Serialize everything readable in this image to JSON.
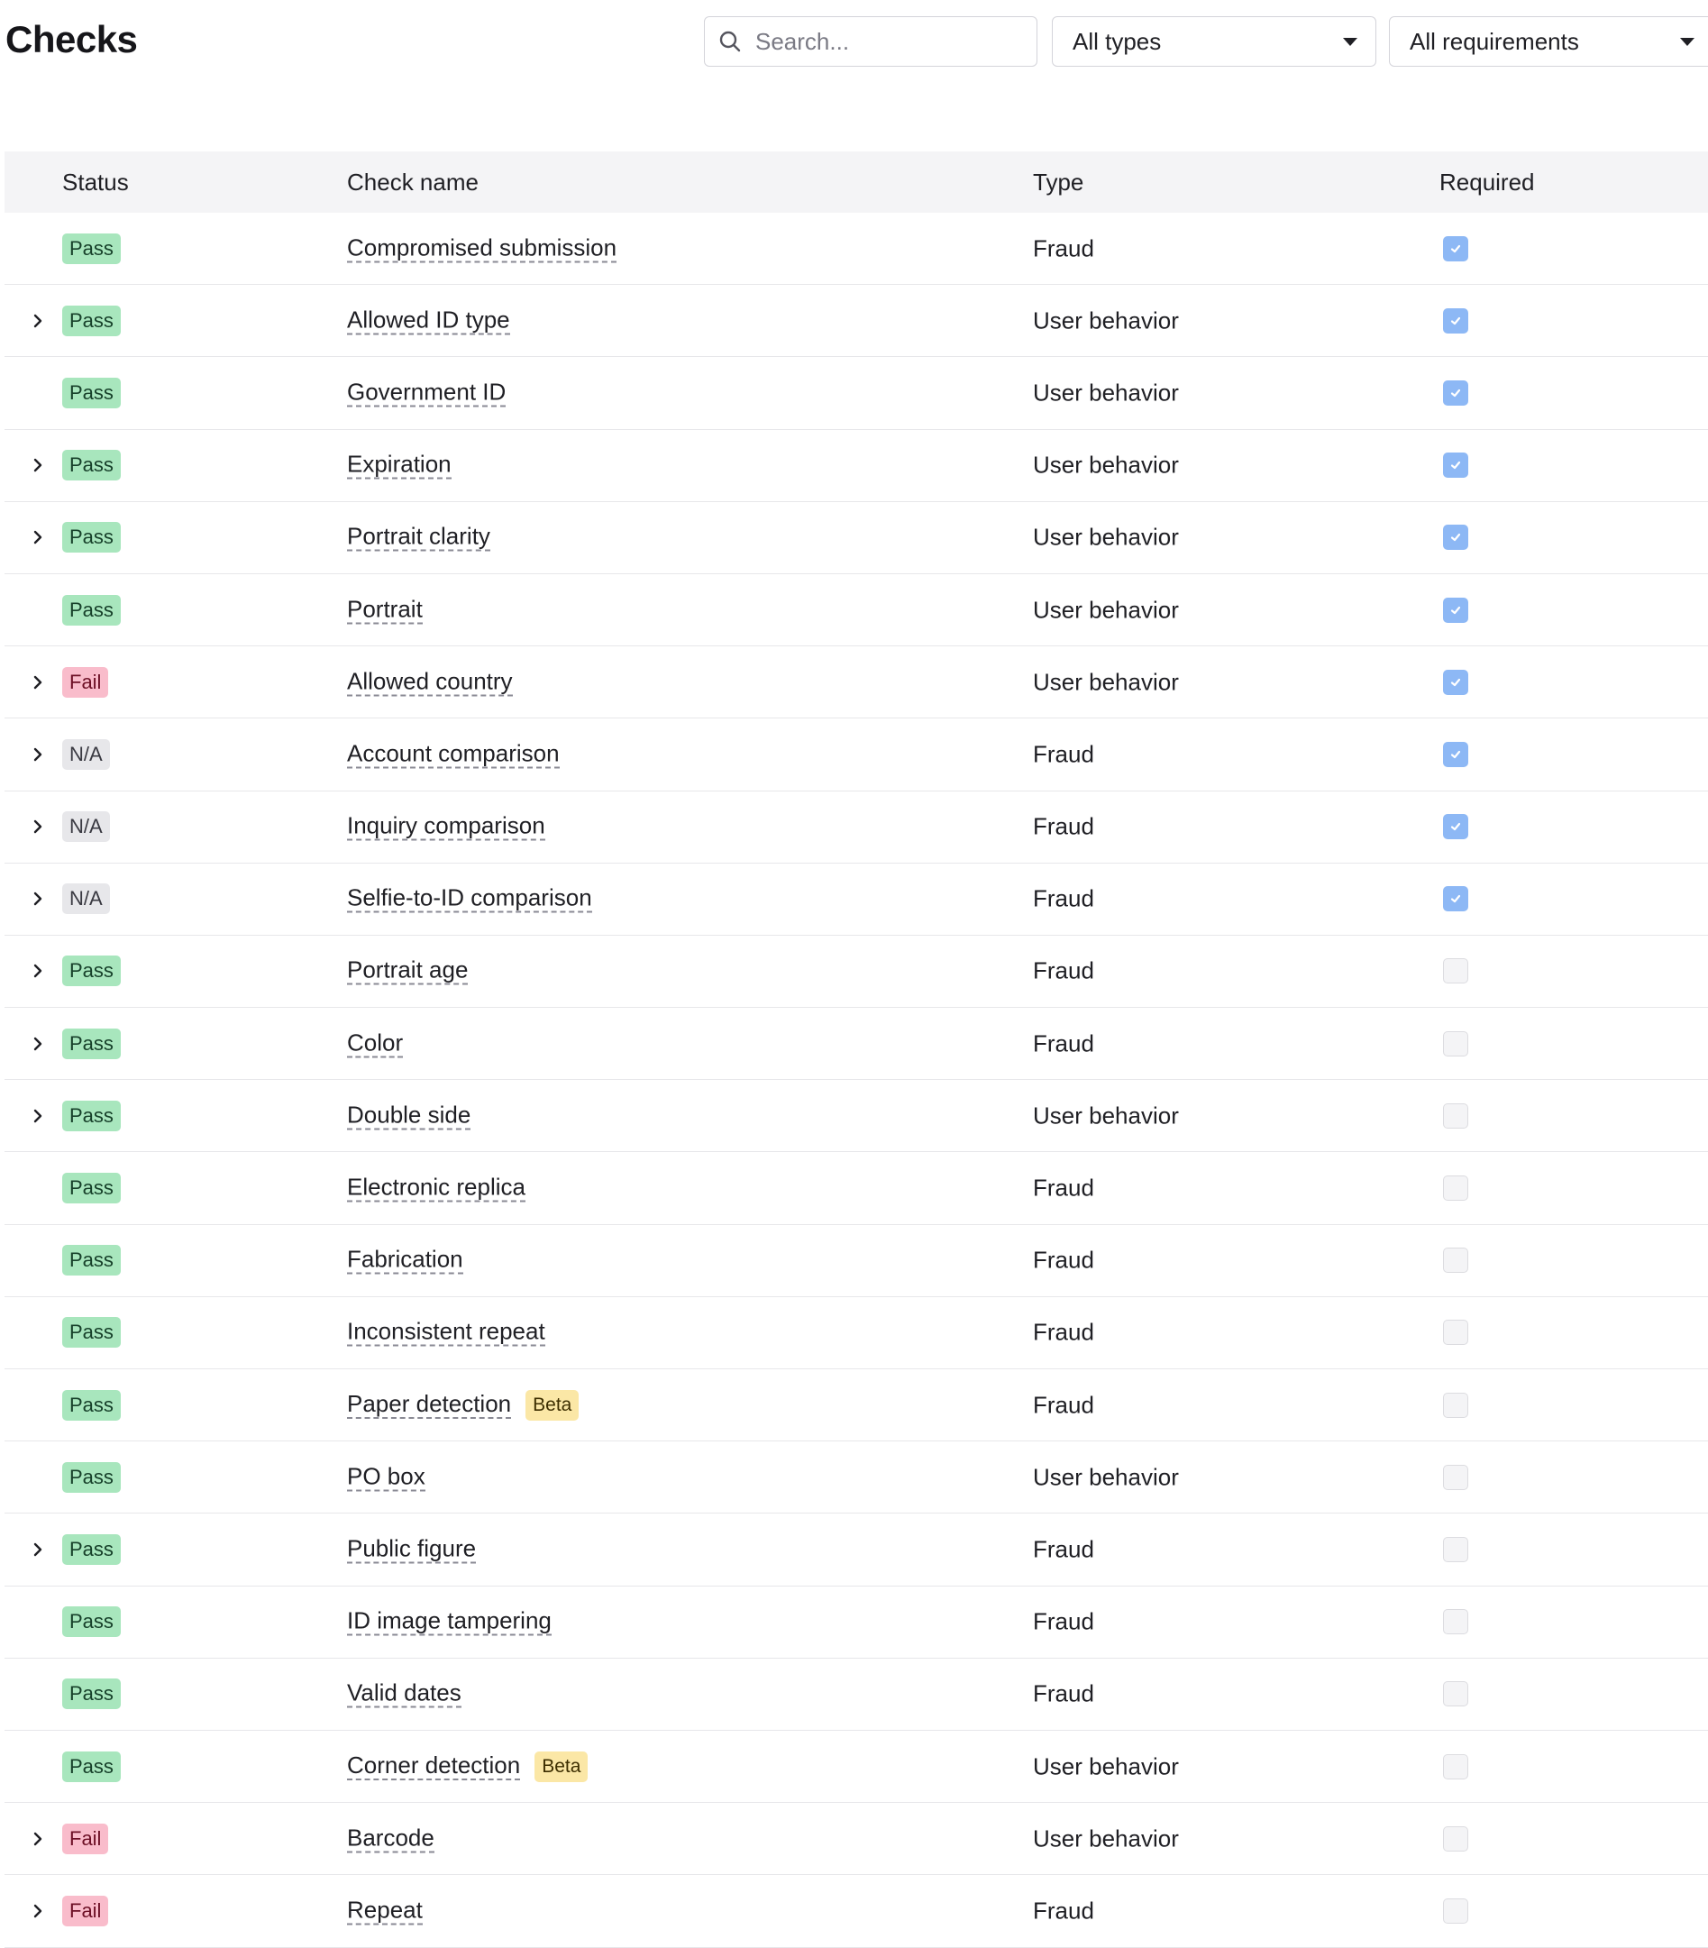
{
  "page": {
    "title": "Checks"
  },
  "filters": {
    "search_placeholder": "Search...",
    "type_select": "All types",
    "requirement_select": "All requirements"
  },
  "colors": {
    "pass_badge": "#a8e6bd",
    "fail_badge": "#f9bccb",
    "na_badge": "#e7e7ea",
    "beta_badge": "#fbe7a6",
    "checkbox_checked": "#8db8f5",
    "header_row_bg": "#f4f4f6"
  },
  "table": {
    "columns": {
      "status": "Status",
      "name": "Check name",
      "type": "Type",
      "required": "Required"
    },
    "rows": [
      {
        "expandable": false,
        "status": "Pass",
        "status_kind": "pass",
        "name": "Compromised submission",
        "beta": "",
        "type": "Fraud",
        "required": true
      },
      {
        "expandable": true,
        "status": "Pass",
        "status_kind": "pass",
        "name": "Allowed ID type",
        "beta": "",
        "type": "User behavior",
        "required": true
      },
      {
        "expandable": false,
        "status": "Pass",
        "status_kind": "pass",
        "name": "Government ID",
        "beta": "",
        "type": "User behavior",
        "required": true
      },
      {
        "expandable": true,
        "status": "Pass",
        "status_kind": "pass",
        "name": "Expiration",
        "beta": "",
        "type": "User behavior",
        "required": true
      },
      {
        "expandable": true,
        "status": "Pass",
        "status_kind": "pass",
        "name": "Portrait clarity",
        "beta": "",
        "type": "User behavior",
        "required": true
      },
      {
        "expandable": false,
        "status": "Pass",
        "status_kind": "pass",
        "name": "Portrait",
        "beta": "",
        "type": "User behavior",
        "required": true
      },
      {
        "expandable": true,
        "status": "Fail",
        "status_kind": "fail",
        "name": "Allowed country",
        "beta": "",
        "type": "User behavior",
        "required": true
      },
      {
        "expandable": true,
        "status": "N/A",
        "status_kind": "na",
        "name": "Account comparison",
        "beta": "",
        "type": "Fraud",
        "required": true
      },
      {
        "expandable": true,
        "status": "N/A",
        "status_kind": "na",
        "name": "Inquiry comparison",
        "beta": "",
        "type": "Fraud",
        "required": true
      },
      {
        "expandable": true,
        "status": "N/A",
        "status_kind": "na",
        "name": "Selfie-to-ID comparison",
        "beta": "",
        "type": "Fraud",
        "required": true
      },
      {
        "expandable": true,
        "status": "Pass",
        "status_kind": "pass",
        "name": "Portrait age",
        "beta": "",
        "type": "Fraud",
        "required": false
      },
      {
        "expandable": true,
        "status": "Pass",
        "status_kind": "pass",
        "name": "Color",
        "beta": "",
        "type": "Fraud",
        "required": false
      },
      {
        "expandable": true,
        "status": "Pass",
        "status_kind": "pass",
        "name": "Double side",
        "beta": "",
        "type": "User behavior",
        "required": false
      },
      {
        "expandable": false,
        "status": "Pass",
        "status_kind": "pass",
        "name": "Electronic replica",
        "beta": "",
        "type": "Fraud",
        "required": false
      },
      {
        "expandable": false,
        "status": "Pass",
        "status_kind": "pass",
        "name": "Fabrication",
        "beta": "",
        "type": "Fraud",
        "required": false
      },
      {
        "expandable": false,
        "status": "Pass",
        "status_kind": "pass",
        "name": "Inconsistent repeat",
        "beta": "",
        "type": "Fraud",
        "required": false
      },
      {
        "expandable": false,
        "status": "Pass",
        "status_kind": "pass",
        "name": "Paper detection",
        "beta": "Beta",
        "type": "Fraud",
        "required": false
      },
      {
        "expandable": false,
        "status": "Pass",
        "status_kind": "pass",
        "name": "PO box",
        "beta": "",
        "type": "User behavior",
        "required": false
      },
      {
        "expandable": true,
        "status": "Pass",
        "status_kind": "pass",
        "name": "Public figure",
        "beta": "",
        "type": "Fraud",
        "required": false
      },
      {
        "expandable": false,
        "status": "Pass",
        "status_kind": "pass",
        "name": "ID image tampering",
        "beta": "",
        "type": "Fraud",
        "required": false
      },
      {
        "expandable": false,
        "status": "Pass",
        "status_kind": "pass",
        "name": "Valid dates",
        "beta": "",
        "type": "Fraud",
        "required": false
      },
      {
        "expandable": false,
        "status": "Pass",
        "status_kind": "pass",
        "name": "Corner detection",
        "beta": "Beta",
        "type": "User behavior",
        "required": false
      },
      {
        "expandable": true,
        "status": "Fail",
        "status_kind": "fail",
        "name": "Barcode",
        "beta": "",
        "type": "User behavior",
        "required": false
      },
      {
        "expandable": true,
        "status": "Fail",
        "status_kind": "fail",
        "name": "Repeat",
        "beta": "",
        "type": "Fraud",
        "required": false
      }
    ]
  }
}
